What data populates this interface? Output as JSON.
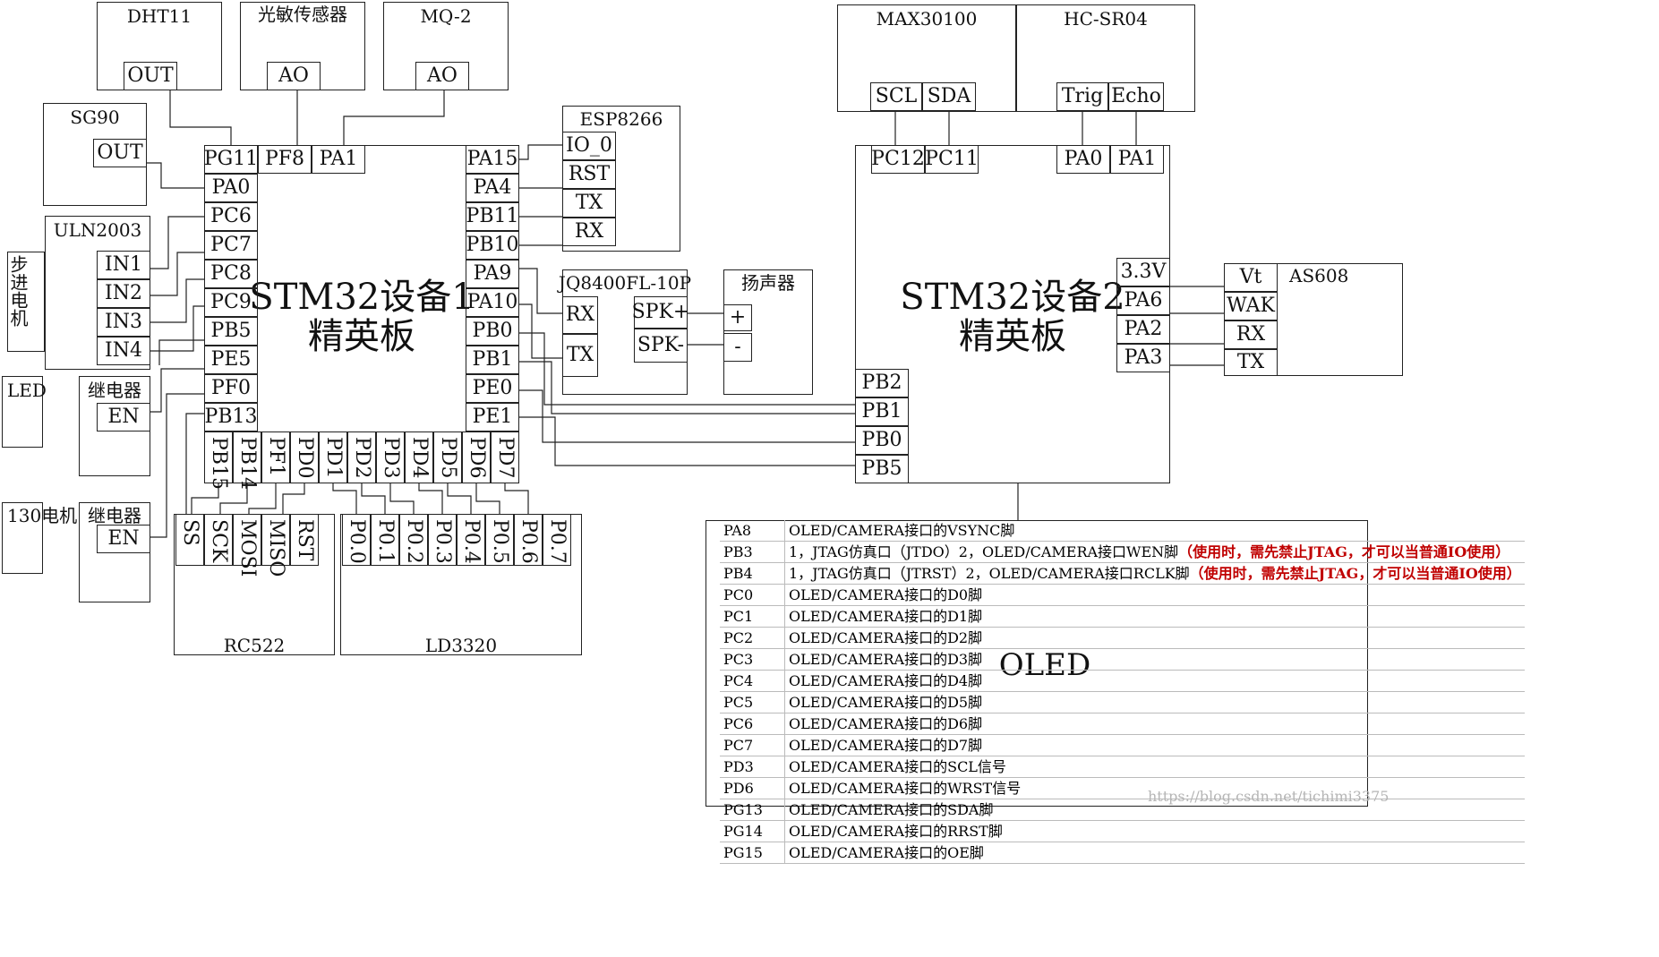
{
  "colors": {
    "line": "#222222",
    "warning": "#c00000",
    "watermark": "#b5b5b5"
  },
  "modules": {
    "dht11": {
      "title": "DHT11",
      "pin": "OUT"
    },
    "light": {
      "title": "光敏传感器",
      "pin": "AO"
    },
    "mq2": {
      "title": "MQ-2",
      "pin": "AO"
    },
    "sg90": {
      "title": "SG90",
      "pin": "OUT"
    },
    "uln2003": {
      "title": "ULN2003",
      "pins": [
        "IN1",
        "IN2",
        "IN3",
        "IN4"
      ]
    },
    "stepper": {
      "title": "步进电机"
    },
    "led": {
      "title": "LED"
    },
    "relay1": {
      "title": "继电器",
      "pin": "EN"
    },
    "motor130": {
      "title": "130电机"
    },
    "relay2": {
      "title": "继电器",
      "pin": "EN"
    },
    "esp8266": {
      "title": "ESP8266",
      "pins": [
        "IO_0",
        "RST",
        "TX",
        "RX"
      ]
    },
    "jq8400": {
      "title": "JQ8400FL-10P",
      "pins": [
        "RX",
        "TX",
        "SPK+",
        "SPK-"
      ]
    },
    "speaker": {
      "title": "扬声器",
      "pins": [
        "+",
        "-"
      ]
    },
    "rc522": {
      "title": "RC522",
      "pins": [
        "SS",
        "SCK",
        "MOSI",
        "MISO",
        "RST"
      ]
    },
    "ld3320": {
      "title": "LD3320",
      "pins": [
        "P0.0",
        "P0.1",
        "P0.2",
        "P0.3",
        "P0.4",
        "P0.5",
        "P0.6",
        "P0.7"
      ]
    },
    "max30100": {
      "title": "MAX30100",
      "pins": [
        "SCL",
        "SDA"
      ]
    },
    "hcsr04": {
      "title": "HC-SR04",
      "pins": [
        "Trig",
        "Echo"
      ]
    },
    "as608": {
      "title": "AS608",
      "pins": [
        "Vt",
        "WAK",
        "RX",
        "TX"
      ]
    }
  },
  "board1": {
    "title_line1": "STM32设备1",
    "title_line2": "精英板",
    "top_pins": [
      "PG11",
      "PF8",
      "PA1"
    ],
    "left_pins": [
      "PA0",
      "PC6",
      "PC7",
      "PC8",
      "PC9",
      "PB5",
      "PE5",
      "PF0",
      "PB13"
    ],
    "right_pins": [
      "PA15",
      "PA4",
      "PB11",
      "PB10",
      "PA9",
      "PA10",
      "PB0",
      "PB1",
      "PE0",
      "PE1"
    ],
    "bottom_pins": [
      "PB15",
      "PB14",
      "PF1",
      "PD0",
      "PD1",
      "PD2",
      "PD3",
      "PD4",
      "PD5",
      "PD6",
      "PD7"
    ]
  },
  "board2": {
    "title_line1": "STM32设备2",
    "title_line2": "精英板",
    "top_pins": [
      "PC12",
      "PC11",
      "PA0",
      "PA1"
    ],
    "right_pins": [
      "3.3V",
      "PA6",
      "PA2",
      "PA3"
    ],
    "left_pins": [
      "PB2",
      "PB1",
      "PB0",
      "PB5"
    ]
  },
  "oled": {
    "label": "OLED",
    "rows": [
      {
        "pin": "PA8",
        "desc": "OLED/CAMERA接口的VSYNC脚"
      },
      {
        "pin": "PB3",
        "desc": "1，JTAG仿真口（JTDO）2，OLED/CAMERA接口WEN脚",
        "warn": "（使用时，需先禁止JTAG，才可以当普通IO使用）"
      },
      {
        "pin": "PB4",
        "desc": "1，JTAG仿真口（JTRST）2，OLED/CAMERA接口RCLK脚",
        "warn": "（使用时，需先禁止JTAG，才可以当普通IO使用）"
      },
      {
        "pin": "PC0",
        "desc": "OLED/CAMERA接口的D0脚"
      },
      {
        "pin": "PC1",
        "desc": "OLED/CAMERA接口的D1脚"
      },
      {
        "pin": "PC2",
        "desc": "OLED/CAMERA接口的D2脚"
      },
      {
        "pin": "PC3",
        "desc": "OLED/CAMERA接口的D3脚"
      },
      {
        "pin": "PC4",
        "desc": "OLED/CAMERA接口的D4脚"
      },
      {
        "pin": "PC5",
        "desc": "OLED/CAMERA接口的D5脚"
      },
      {
        "pin": "PC6",
        "desc": "OLED/CAMERA接口的D6脚"
      },
      {
        "pin": "PC7",
        "desc": "OLED/CAMERA接口的D7脚"
      },
      {
        "pin": "PD3",
        "desc": "OLED/CAMERA接口的SCL信号"
      },
      {
        "pin": "PD6",
        "desc": "OLED/CAMERA接口的WRST信号"
      },
      {
        "pin": "PG13",
        "desc": "OLED/CAMERA接口的SDA脚"
      },
      {
        "pin": "PG14",
        "desc": "OLED/CAMERA接口的RRST脚"
      },
      {
        "pin": "PG15",
        "desc": "OLED/CAMERA接口的OE脚"
      }
    ]
  },
  "watermark": "https://blog.csdn.net/tichimi3375"
}
